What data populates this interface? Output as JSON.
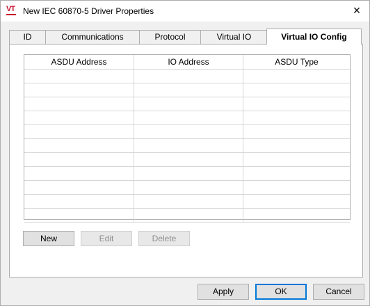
{
  "window": {
    "title": "New IEC 60870-5 Driver Properties",
    "close_glyph": "×",
    "icon": "vt-app-icon",
    "icon_text": "VT"
  },
  "tabs": [
    {
      "label": "ID"
    },
    {
      "label": "Communications"
    },
    {
      "label": "Protocol"
    },
    {
      "label": "Virtual IO"
    },
    {
      "label": "Virtual IO Config"
    }
  ],
  "active_tab": "Virtual IO Config",
  "grid": {
    "columns": [
      "ASDU Address",
      "IO Address",
      "ASDU Type"
    ],
    "rows": []
  },
  "panel_buttons": {
    "new_label": "New",
    "edit_label": "Edit",
    "delete_label": "Delete"
  },
  "footer_buttons": {
    "apply_label": "Apply",
    "ok_label": "OK",
    "cancel_label": "Cancel"
  },
  "colors": {
    "active_tab_bg": "#ffffff",
    "disabled_text": "#8d8d8d",
    "focus_border": "#0078d7",
    "brand_red": "#c8102e"
  }
}
